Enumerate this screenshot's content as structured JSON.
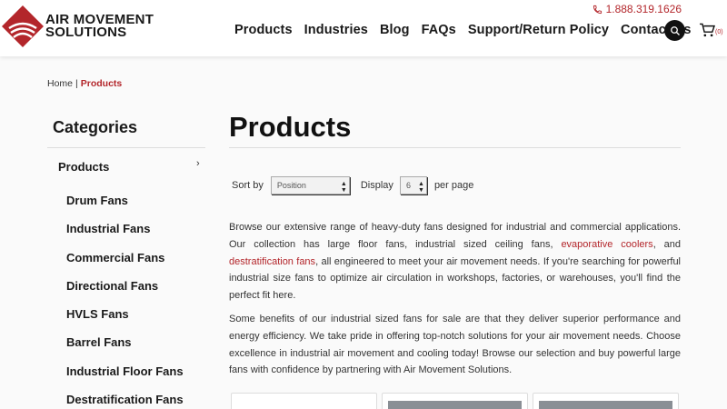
{
  "brand": {
    "name": "AIR MOVEMENT SOLUTIONS",
    "line1": "AIR MOVEMENT",
    "line2": "SOLUTIONS",
    "accent_color": "#b3262b"
  },
  "header": {
    "phone": "1.888.319.1626",
    "nav": [
      "Products",
      "Industries",
      "Blog",
      "FAQs",
      "Support/Return Policy",
      "Contact Us"
    ],
    "cart_count": "(0)"
  },
  "breadcrumb": {
    "home": "Home",
    "separator": "|",
    "current": "Products"
  },
  "sidebar": {
    "title": "Categories",
    "parent": "Products",
    "items": [
      "Drum Fans",
      "Industrial Fans",
      "Commercial Fans",
      "Directional Fans",
      "HVLS Fans",
      "Barrel Fans",
      "Industrial Floor Fans",
      "Destratification Fans"
    ]
  },
  "main": {
    "title": "Products",
    "sort_label": "Sort by",
    "sort_value": "Position",
    "display_label": "Display",
    "display_value": "6",
    "per_page_label": "per page",
    "desc1_a": "Browse our extensive range of heavy-duty fans designed for industrial and commercial applications. Our collection has large floor fans, industrial sized ceiling fans, ",
    "desc1_link1": "evaporative coolers",
    "desc1_b": ", and ",
    "desc1_link2": "destratification fans",
    "desc1_c": ", all engineered to meet your air movement needs. If you're searching for powerful industrial size fans to optimize air circulation in workshops, factories, or warehouses, you'll find the perfect fit here.",
    "desc2": "Some benefits of our industrial sized fans for sale are that they deliver superior performance and energy efficiency. We take pride in offering top-notch solutions for your air movement needs. Choose excellence in industrial air movement and cooling today! Browse our selection and buy powerful large fans with confidence by partnering with Air Movement Solutions."
  }
}
